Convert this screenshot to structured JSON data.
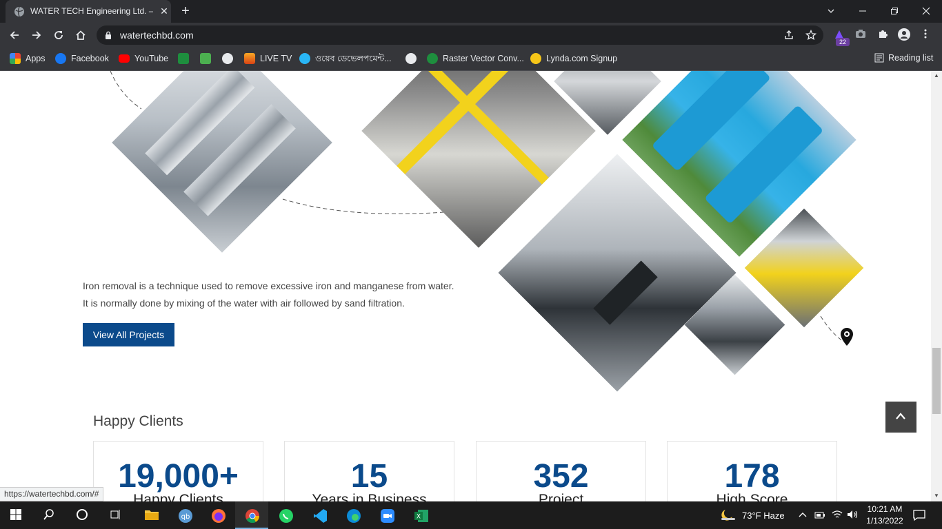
{
  "browser": {
    "tab_title": "WATER TECH Engineering Ltd. – v",
    "url": "watertechbd.com",
    "bookmarks": [
      {
        "label": "Apps",
        "icon": "apps-grid-icon",
        "color": "#ea4335"
      },
      {
        "label": "Facebook",
        "icon": "facebook-icon",
        "color": "#1877f2"
      },
      {
        "label": "YouTube",
        "icon": "youtube-icon",
        "color": "#ff0000"
      },
      {
        "label": "",
        "icon": "bookmark-green-icon",
        "color": "#1e8e3e"
      },
      {
        "label": "",
        "icon": "chart-icon",
        "color": "#4caf50"
      },
      {
        "label": "",
        "icon": "globe-icon",
        "color": "#e8eaed"
      },
      {
        "label": "LIVE TV",
        "icon": "live-tv-icon",
        "color": "#f9a825"
      },
      {
        "label": "ওয়েব ডেভেলপমেন্ট...",
        "icon": "web-dev-icon",
        "color": "#29b6f6"
      },
      {
        "label": "",
        "icon": "globe-icon",
        "color": "#e8eaed"
      },
      {
        "label": "Raster Vector Conv...",
        "icon": "raster-vector-icon",
        "color": "#1e8e3e"
      },
      {
        "label": "Lynda.com Signup",
        "icon": "lynda-icon",
        "color": "#f5c518"
      }
    ],
    "reading_list": "Reading list",
    "extension_badge": "22",
    "status_url": "https://watertechbd.com/#"
  },
  "page": {
    "description_line1": "Iron removal is a technique used to remove excessive iron and manganese from water.",
    "description_line2": "It is normally done by mixing of the water with air followed by sand filtration.",
    "view_all_label": "View All Projects",
    "happy_clients_title": "Happy Clients",
    "stats": [
      {
        "number": "19,000+",
        "label": "Happy Clients"
      },
      {
        "number": "15",
        "label": "Years in Business"
      },
      {
        "number": "352",
        "label": "Project"
      },
      {
        "number": "178",
        "label": "High Score"
      }
    ],
    "accent_color": "#0b4a8b"
  },
  "taskbar": {
    "weather": "73°F  Haze",
    "time": "10:21 AM",
    "date": "1/13/2022"
  }
}
